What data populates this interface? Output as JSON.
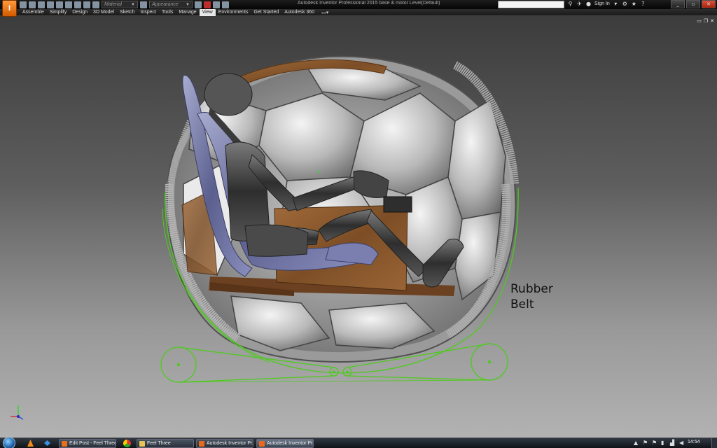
{
  "titlebar": {
    "app_button_label": "I",
    "material_placeholder": "Material",
    "appearance_placeholder": "Appearance",
    "window_title": "Autodesk Inventor Professional 2015  base & motor  Level(Default)",
    "signin_label": "Sign In"
  },
  "ribbon": {
    "tabs": [
      "Assemble",
      "Simplify",
      "Design",
      "3D Model",
      "Sketch",
      "Inspect",
      "Tools",
      "Manage",
      "View",
      "Environments",
      "Get Started",
      "Autodesk 360"
    ],
    "active_tab": "View"
  },
  "viewport": {
    "annotation_line1": "Rubber",
    "annotation_line2": "Belt",
    "sketch_color": "#4ccc1a",
    "wood_color": "#8a5a2e"
  },
  "taskbar": {
    "tasks": [
      {
        "label": "Edit Post - Feel Three...",
        "icon": "firefox-icon",
        "color": "#e8701a"
      },
      {
        "label": "Feel Three",
        "icon": "folder-icon",
        "color": "#e7c45a"
      },
      {
        "label": "Autodesk Inventor Pr...",
        "icon": "inventor-icon",
        "color": "#e86a1a"
      },
      {
        "label": "Autodesk Inventor Pr...",
        "icon": "inventor-icon",
        "color": "#e86a1a"
      }
    ],
    "clock": "14:54"
  },
  "colors": {
    "accent": "#e86a1a",
    "titlebar_bg": "#0d0d0d",
    "viewport_top": "#3c3c3c",
    "viewport_bottom": "#b2b2b2"
  }
}
